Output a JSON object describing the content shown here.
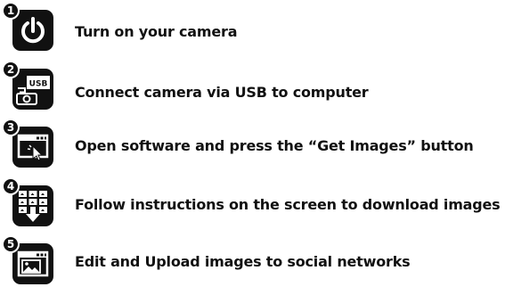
{
  "steps": [
    {
      "number": "1",
      "icon": "power-icon",
      "text": "Turn on your camera"
    },
    {
      "number": "2",
      "icon": "camera-usb-icon",
      "usb_label": "USB",
      "text": "Connect camera via USB to computer"
    },
    {
      "number": "3",
      "icon": "software-click-icon",
      "text": "Open software and press the “Get Images” button"
    },
    {
      "number": "4",
      "icon": "download-images-icon",
      "text": "Follow instructions on the screen to download images"
    },
    {
      "number": "5",
      "icon": "upload-image-icon",
      "text": "Edit and Upload images to social networks"
    }
  ],
  "colors": {
    "icon_background": "#111111",
    "icon_foreground": "#ffffff",
    "text": "#111111"
  }
}
